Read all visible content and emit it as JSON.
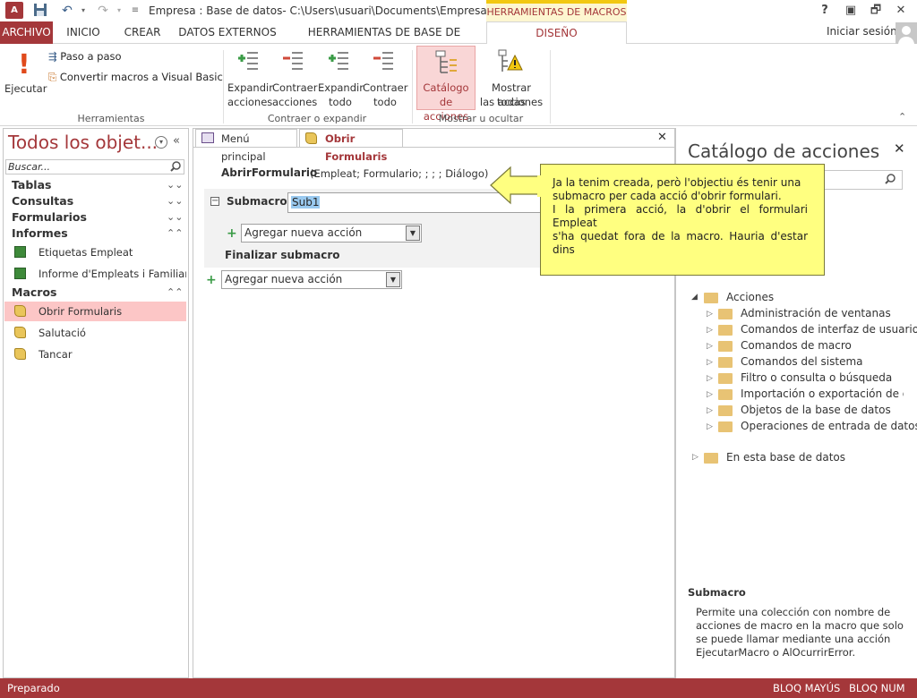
{
  "window": {
    "title": "Empresa : Base de datos- C:\\Users\\usuari\\Documents\\Empresa.acc...",
    "tool_context": "HERRAMIENTAS DE MACROS",
    "help": "?",
    "restore": "🗗",
    "min": "—",
    "close": "✕"
  },
  "tabs": {
    "archivo": "ARCHIVO",
    "inicio": "INICIO",
    "crear": "CREAR",
    "datos_externos": "DATOS EXTERNOS",
    "herramientas_bd": "HERRAMIENTAS DE BASE DE DATOS",
    "diseno": "DISEÑO",
    "signin": "Iniciar sesión"
  },
  "ribbon": {
    "ejecutar": "Ejecutar",
    "paso_a_paso": "Paso a paso",
    "convertir": "Convertir macros a Visual Basic",
    "group_herramientas": "Herramientas",
    "expandir_acciones": [
      "Expandir",
      "acciones"
    ],
    "contraer_acciones": [
      "Contraer",
      "acciones"
    ],
    "expandir_todo": [
      "Expandir",
      "todo"
    ],
    "contraer_todo": [
      "Contraer",
      "todo"
    ],
    "group_contraer": "Contraer o expandir",
    "catalogo": [
      "Catálogo",
      "de acciones"
    ],
    "mostrar_todas": [
      "Mostrar todas",
      "las acciones"
    ],
    "group_mostrar": "Mostrar u ocultar"
  },
  "nav": {
    "title": "Todos los objet...",
    "search_placeholder": "Buscar...",
    "tablas": "Tablas",
    "consultas": "Consultas",
    "formularios": "Formularios",
    "informes": "Informes",
    "informe_items": [
      "Etiquetas Empleat",
      "Informe d'Empleats i Familiar..."
    ],
    "macros": "Macros",
    "macro_items": [
      "Obrir Formularis",
      "Salutació",
      "Tancar"
    ]
  },
  "doc": {
    "tabs": [
      "Menú principal",
      "Obrir Formularis"
    ],
    "action_name": "AbrirFormulario",
    "action_args": "(Empleat; Formulario; ; ; ; Diálogo)",
    "submacro_label": "Submacro:",
    "submacro_value": "Sub1",
    "add_action": "Agregar nueva acción",
    "end_submacro": "Finalizar submacro",
    "add_action_outer": "Agregar nueva acción"
  },
  "callout": {
    "lines": [
      "Ja la tenim creada, però l'objectiu és tenir una",
      "submacro per cada acció d'obrir formulari.",
      "I la primera acció, la d'obrir el formulari Empleat",
      "s'ha quedat fora de la macro. Hauria d'estar dins"
    ]
  },
  "catalog": {
    "title": "Catálogo de acciones",
    "acciones": "Acciones",
    "folders": [
      "Administración de ventanas",
      "Comandos de interfaz de usuario",
      "Comandos de macro",
      "Comandos del sistema",
      "Filtro o consulta o búsqueda",
      "Importación o exportación de datc",
      "Objetos de la base de datos",
      "Operaciones de entrada de datos"
    ],
    "en_esta_bd": "En esta base de datos",
    "desc_title": "Submacro",
    "desc_lines": [
      "Permite una colección con nombre de",
      "acciones de macro en la macro que solo",
      "se puede llamar mediante una acción",
      "EjecutarMacro o AlOcurrirError."
    ]
  },
  "status": {
    "left": "Preparado",
    "caps": "BLOQ MAYÚS",
    "num": "BLOQ NUM"
  },
  "colors": {
    "accent": "#a4373a",
    "callout": "#ffff80",
    "macro_tab": "#f2c811"
  }
}
